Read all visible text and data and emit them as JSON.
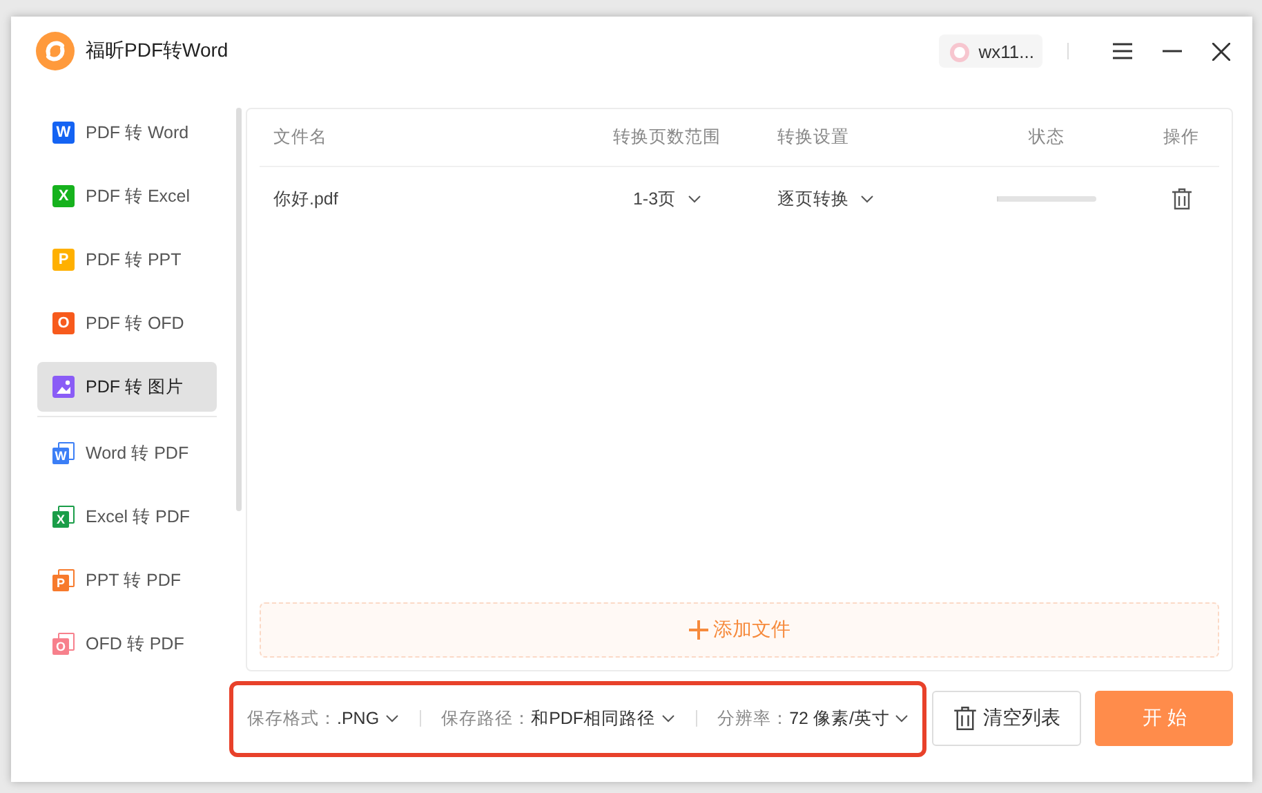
{
  "window": {
    "title": "福昕PDF转Word",
    "user": "wx11..."
  },
  "sidebar": {
    "groups": [
      [
        {
          "label": "PDF 转 Word",
          "icon": "W",
          "color": "#1463f3",
          "kind": "solid",
          "selected": false
        },
        {
          "label": "PDF 转 Excel",
          "icon": "X",
          "color": "#16b21d",
          "kind": "solid",
          "selected": false
        },
        {
          "label": "PDF 转 PPT",
          "icon": "P",
          "color": "#ffb000",
          "kind": "solid",
          "selected": false
        },
        {
          "label": "PDF 转 OFD",
          "icon": "O",
          "color": "#f75a1c",
          "kind": "solid",
          "selected": false
        },
        {
          "label": "PDF 转 图片",
          "color": "#8a5cf6",
          "kind": "image",
          "selected": true
        }
      ],
      [
        {
          "label": "Word 转 PDF",
          "icon": "W",
          "color": "#3b7ef6",
          "kind": "layered",
          "selected": false
        },
        {
          "label": "Excel 转 PDF",
          "icon": "X",
          "color": "#1a9d48",
          "kind": "layered",
          "selected": false
        },
        {
          "label": "PPT 转 PDF",
          "icon": "P",
          "color": "#f77a2c",
          "kind": "layered",
          "selected": false
        },
        {
          "label": "OFD 转 PDF",
          "icon": "O",
          "color": "#f7808c",
          "kind": "layered",
          "selected": false
        }
      ]
    ]
  },
  "table": {
    "columns": [
      "文件名",
      "转换页数范围",
      "转换设置",
      "状态",
      "操作"
    ],
    "rows": [
      {
        "file": "你好.pdf",
        "range": "1-3页",
        "setting": "逐页转换",
        "level": 0
      }
    ]
  },
  "add_file": "添加文件",
  "options": {
    "highlighted": true,
    "items": [
      {
        "label": "保存格式：",
        "value": ".PNG"
      },
      {
        "label": "保存路径：",
        "value": "和PDF相同路径"
      },
      {
        "label": "分辨率：",
        "value": "72 像素/英寸"
      }
    ]
  },
  "clear_button": "清空列表",
  "start_button": "开 始"
}
